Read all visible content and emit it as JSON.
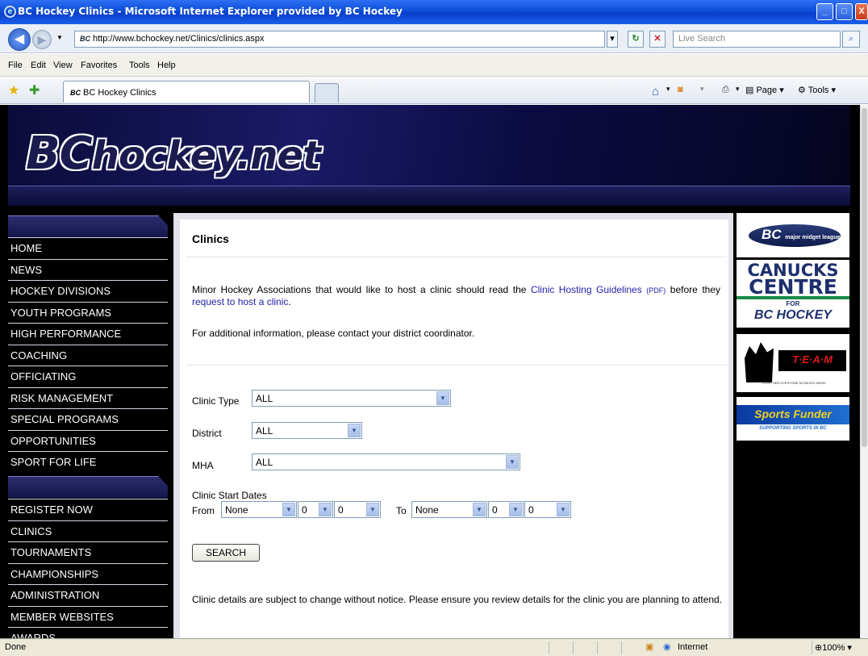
{
  "window": {
    "title": "BC Hockey Clinics - Microsoft Internet Explorer provided by BC Hockey",
    "min": "_",
    "max": "□",
    "close": "X"
  },
  "address": {
    "url": "http://www.bchockey.net/Clinics/clinics.aspx",
    "favicon_text": "BC",
    "search_placeholder": "Live Search"
  },
  "menu": {
    "items": [
      "File",
      "Edit",
      "View",
      "Favorites",
      "Tools",
      "Help"
    ]
  },
  "tab": {
    "label": "BC Hockey Clinics",
    "favicon_text": "BC"
  },
  "commands": {
    "page": "Page",
    "tools": "Tools"
  },
  "banner": {
    "logo_bc": "BC",
    "logo_rest": "hockey.net"
  },
  "sidebar": {
    "group1": [
      "HOME",
      "NEWS",
      "HOCKEY DIVISIONS",
      "YOUTH PROGRAMS",
      "HIGH PERFORMANCE",
      "COACHING",
      "OFFICIATING",
      "RISK MANAGEMENT",
      "SPECIAL PROGRAMS",
      "OPPORTUNITIES",
      "SPORT FOR LIFE"
    ],
    "group2": [
      "REGISTER NOW",
      "CLINICS",
      "TOURNAMENTS",
      "CHAMPIONSHIPS",
      "ADMINISTRATION",
      "MEMBER WEBSITES",
      "AWARDS"
    ]
  },
  "main": {
    "heading": "Clinics",
    "intro_before": "Minor Hockey Associations that would like to host a clinic should read the ",
    "link_guidelines": "Clinic Hosting Guidelines",
    "pdf_tag": "(PDF)",
    "intro_middle": " before they ",
    "link_request": "request to host a clinic",
    "intro_end": ".",
    "contact_text": "For additional information, please contact your district coordinator.",
    "clinic_type_label": "Clinic Type",
    "clinic_type_value": "ALL",
    "district_label": "District",
    "district_value": "ALL",
    "mha_label": "MHA",
    "mha_value": "ALL",
    "dates_label": "Clinic Start Dates",
    "from_label": "From",
    "from_month": "None",
    "from_day": "0",
    "from_year": "0",
    "to_label": "To",
    "to_month": "None",
    "to_day": "0",
    "to_year": "0",
    "search_button": "SEARCH",
    "disclaimer": "Clinic details are subject to change without notice. Please ensure you review details for the clinic you are planning to attend."
  },
  "ads": {
    "mml_logo": "BC",
    "mml_text": "major midget league",
    "canucks_line1": "CANUCKS",
    "canucks_line2": "CENTRE",
    "canucks_for": "FOR",
    "canucks_line3": "BC HOCKEY",
    "team_text": "T·E·A·M",
    "team_sub": "TOGETHER EVERYONE ACHIEVES MORE",
    "sports_funder": "Sports Funder",
    "sports_funder_sub": "SUPPORTING SPORTS IN BC"
  },
  "status": {
    "text": "Done",
    "zone": "Internet",
    "zoom": "100%"
  },
  "colors": {
    "titlebar": "#0a4ed6",
    "nav_bg": "#000000",
    "link": "#2222aa"
  }
}
